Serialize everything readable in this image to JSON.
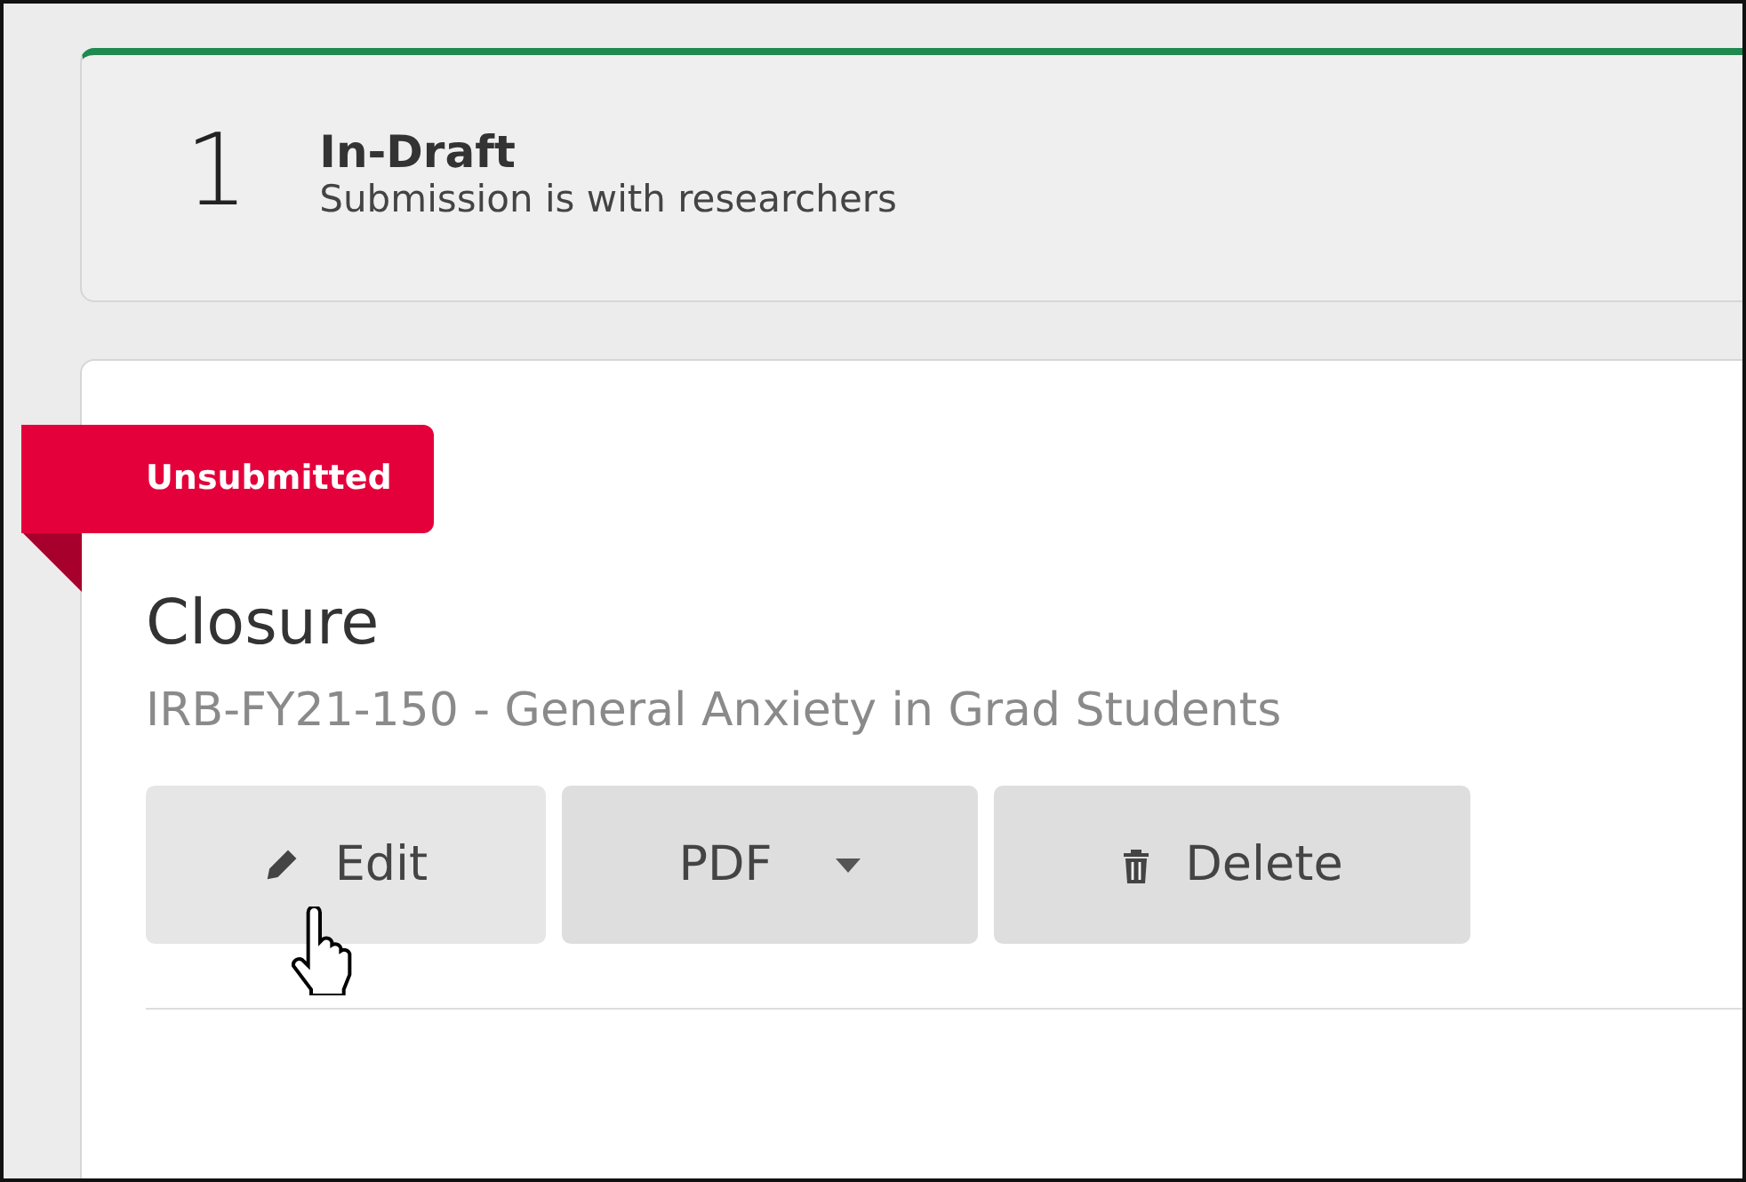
{
  "status_card": {
    "count": "1",
    "title": "In-Draft",
    "subtitle": "Submission is with researchers"
  },
  "submission": {
    "badge": "Unsubmitted",
    "title": "Closure",
    "subtitle": "IRB-FY21-150 - General Anxiety in Grad Students",
    "buttons": [
      {
        "kind": "edit",
        "label": "Edit",
        "hovered": true
      },
      {
        "kind": "dropdown",
        "label": "PDF",
        "hovered": false
      },
      {
        "kind": "delete",
        "label": "Delete",
        "hovered": false
      }
    ]
  }
}
